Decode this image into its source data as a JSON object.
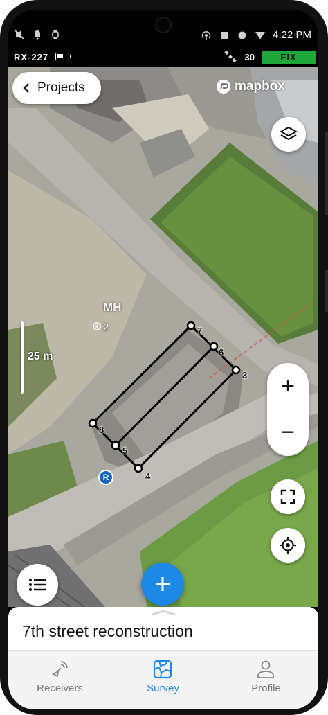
{
  "status_bar": {
    "time": "4:22 PM",
    "left_icons": [
      "mute-icon",
      "bell-icon",
      "watch-icon"
    ],
    "right_icons": [
      "hotspot-icon",
      "square-icon",
      "circle-icon",
      "wifi-triangle-icon"
    ]
  },
  "receiver_bar": {
    "receiver_name": "RX-227",
    "satellite_count": "30",
    "fix_status": "FIX",
    "fix_color": "#1fa83a"
  },
  "map": {
    "back_label": "Projects",
    "attribution": "mapbox",
    "scale_label": "25 m",
    "manhole_label": "MH",
    "manhole_number": "2",
    "reference_marker": "R",
    "zoom_in": "+",
    "zoom_out": "−",
    "points": [
      {
        "label": "7"
      },
      {
        "label": "6"
      },
      {
        "label": "3"
      },
      {
        "label": "4"
      },
      {
        "label": "5"
      },
      {
        "label": "8"
      }
    ]
  },
  "project": {
    "title": "7th street reconstruction"
  },
  "tabs": [
    {
      "label": "Receivers",
      "icon": "receiver-icon",
      "active": false
    },
    {
      "label": "Survey",
      "icon": "survey-icon",
      "active": true
    },
    {
      "label": "Profile",
      "icon": "profile-icon",
      "active": false
    }
  ],
  "colors": {
    "accent": "#1e88e5",
    "fix": "#1fa83a"
  }
}
